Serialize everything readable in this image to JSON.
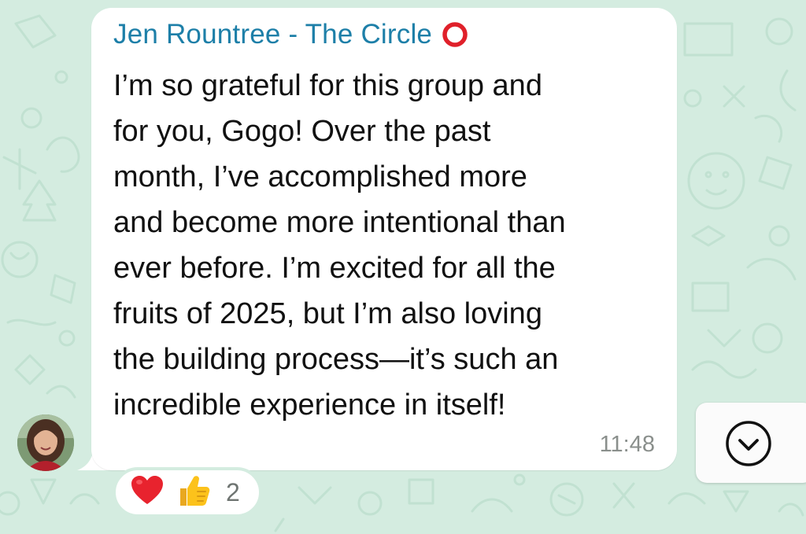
{
  "message": {
    "sender_name": "Jen Rountree - The Circle",
    "sender_badge_icon": "hollow-red-circle-icon",
    "text": "I’m so grateful for this group and\nfor you, Gogo! Over the past\nmonth, I’ve accomplished more\nand become more intentional than\never before. I’m excited for all the\nfruits of 2025, but I’m also loving\nthe building process—it’s such an\nincredible experience in itself!",
    "time": "11:48",
    "avatar_icon": "profile-photo"
  },
  "reactions": {
    "emojis": [
      "heart-icon",
      "thumbs-up-icon"
    ],
    "count": "2"
  },
  "scroll_button": {
    "icon": "chevron-down-circle-icon"
  },
  "colors": {
    "background": "#d4ece0",
    "sender_name": "#1d7fa8",
    "bubble": "#ffffff",
    "timestamp": "#8a8f8c"
  }
}
